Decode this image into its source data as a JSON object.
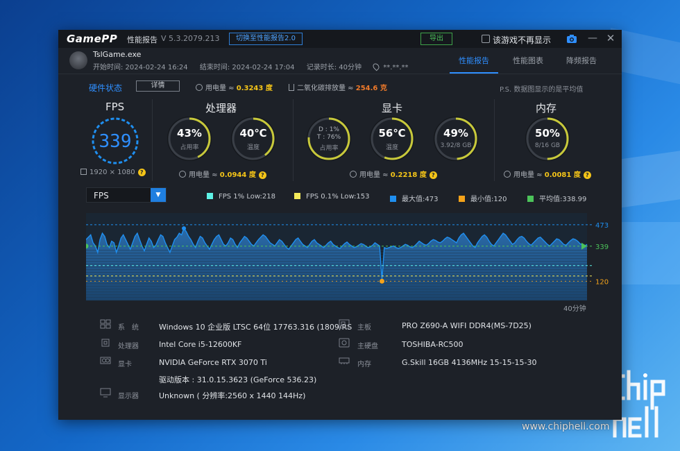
{
  "window": {
    "logo": "GamePP",
    "title": "性能报告",
    "version": "V 5.3.2079.213",
    "switch_label": "切换至性能报告2.0",
    "export_label": "导出",
    "no_show_label": "该游戏不再显示",
    "minimize": "—",
    "close": "✕"
  },
  "session": {
    "exe": "TslGame.exe",
    "start": "开始时间: 2024-02-24 16:24",
    "end": "结束时间: 2024-02-24 17:04",
    "duration": "记录时长: 40分钟",
    "location": "**.**.**"
  },
  "tabs": [
    {
      "label": "性能报告",
      "active": true
    },
    {
      "label": "性能图表",
      "active": false
    },
    {
      "label": "降频报告",
      "active": false
    }
  ],
  "hardware_status": {
    "title": "硬件状态",
    "detail_label": "详情",
    "power_prefix": "用电量 ≈ ",
    "power_value": "0.3243 度",
    "co2_prefix": "二氧化碳排放量 ≈ ",
    "co2_value": "254.6 克",
    "note": "P.S. 数据图显示的是平均值"
  },
  "sections": {
    "fps": {
      "title": "FPS",
      "value": "339",
      "resolution": "1920 × 1080"
    },
    "cpu": {
      "title": "处理器",
      "usage": {
        "value": "43%",
        "label": "占用率",
        "fraction": 0.43
      },
      "temp": {
        "value": "40℃",
        "label": "温度",
        "fraction": 0.4
      },
      "power_prefix": "用电量 ≈ ",
      "power_value": "0.0944 度"
    },
    "gpu": {
      "title": "显卡",
      "usage": {
        "line1": "D : 1%",
        "line2": "T : 76%",
        "label": "占用率",
        "fraction": 0.76
      },
      "temp": {
        "value": "56℃",
        "label": "温度",
        "fraction": 0.56
      },
      "vram": {
        "value": "49%",
        "label": "3.92/8 GB",
        "fraction": 0.49
      },
      "power_prefix": "用电量 ≈ ",
      "power_value": "0.2218 度"
    },
    "memory": {
      "title": "内存",
      "usage": {
        "value": "50%",
        "label": "8/16 GB",
        "fraction": 0.5
      },
      "power_prefix": "用电量 ≈ ",
      "power_value": "0.0081 度"
    }
  },
  "metric_select": {
    "selected": "FPS"
  },
  "legend": [
    {
      "label": "FPS 1% Low:218",
      "color": "#5ef2e6"
    },
    {
      "label": "FPS 0.1% Low:153",
      "color": "#f3ea5a"
    },
    {
      "label": "最大值:473",
      "color": "#1f8ff0"
    },
    {
      "label": "最小值:120",
      "color": "#f5a31a"
    },
    {
      "label": "平均值:338.99",
      "color": "#4cc35a"
    }
  ],
  "chart_data": {
    "type": "area",
    "ylim": [
      0,
      520
    ],
    "max": 473,
    "min": 120,
    "avg": 338.99,
    "low1": 218,
    "low01": 153,
    "tick_labels": {
      "max": "473",
      "avg": "339",
      "min": "120"
    },
    "x_end_label": "40分钟",
    "values": [
      380,
      395,
      410,
      360,
      340,
      300,
      380,
      420,
      400,
      350,
      330,
      370,
      360,
      300,
      340,
      390,
      410,
      380,
      350,
      320,
      360,
      400,
      420,
      380,
      340,
      310,
      350,
      390,
      370,
      330,
      345,
      380,
      410,
      400,
      360,
      330,
      300,
      340,
      380,
      395,
      420,
      410,
      450,
      430,
      400,
      380,
      350,
      330,
      370,
      400,
      390,
      360,
      340,
      320,
      350,
      380,
      400,
      410,
      380,
      350,
      340,
      360,
      390,
      380,
      350,
      330,
      360,
      380,
      400,
      390,
      370,
      350,
      340,
      360,
      380,
      395,
      410,
      400,
      380,
      360,
      350,
      340,
      360,
      380,
      370,
      350,
      330,
      320,
      340,
      360,
      380,
      390,
      370,
      350,
      340,
      330,
      350,
      370,
      380,
      360,
      350,
      340,
      330,
      345,
      360,
      370,
      350,
      340,
      330,
      325,
      340,
      355,
      365,
      350,
      340,
      330,
      335,
      345,
      355,
      350,
      340,
      330,
      335,
      345,
      360,
      350,
      340,
      130,
      330,
      325,
      330,
      335,
      340,
      330,
      325,
      330,
      340,
      350,
      345,
      335,
      330,
      340,
      355,
      370,
      360,
      350,
      345,
      355,
      370,
      380,
      375,
      365,
      360,
      370,
      385,
      395,
      390,
      380,
      370,
      360,
      390,
      410,
      420,
      400,
      380,
      360,
      340,
      330,
      360,
      380,
      400,
      410,
      395,
      370,
      350,
      340,
      360,
      380,
      400,
      420,
      410,
      390,
      370,
      350,
      360,
      380,
      395,
      400,
      390,
      370,
      355,
      345,
      360,
      375,
      390,
      395,
      380,
      365,
      350,
      340,
      355,
      370,
      385,
      380,
      365,
      350,
      345,
      360,
      375,
      385,
      380,
      370,
      355,
      345,
      340,
      350
    ]
  },
  "chart_minpoint_index": 127,
  "specs": {
    "os": {
      "label": "系　统",
      "value": "Windows 10 企业版 LTSC 64位 17763.316 (1809/RS"
    },
    "motherboard": {
      "label": "主板",
      "value": "PRO Z690-A WIFI DDR4(MS-7D25)"
    },
    "cpu": {
      "label": "处理器",
      "value": "Intel Core i5-12600KF"
    },
    "disk": {
      "label": "主硬盘",
      "value": "TOSHIBA-RC500"
    },
    "gpu": {
      "label": "显卡",
      "value": "NVIDIA GeForce RTX 3070 Ti"
    },
    "ram": {
      "label": "内存",
      "value": "G.Skill 16GB 4136MHz 15-15-15-30"
    },
    "driver": {
      "value": "驱动版本 : 31.0.15.3623 (GeForce 536.23)"
    },
    "display": {
      "label": "显示器",
      "value": "Unknown ( 分辨率:2560 x 1440 144Hz)"
    }
  },
  "watermark": {
    "logo_text": "chiphell",
    "url": "www.chiphell.com"
  }
}
